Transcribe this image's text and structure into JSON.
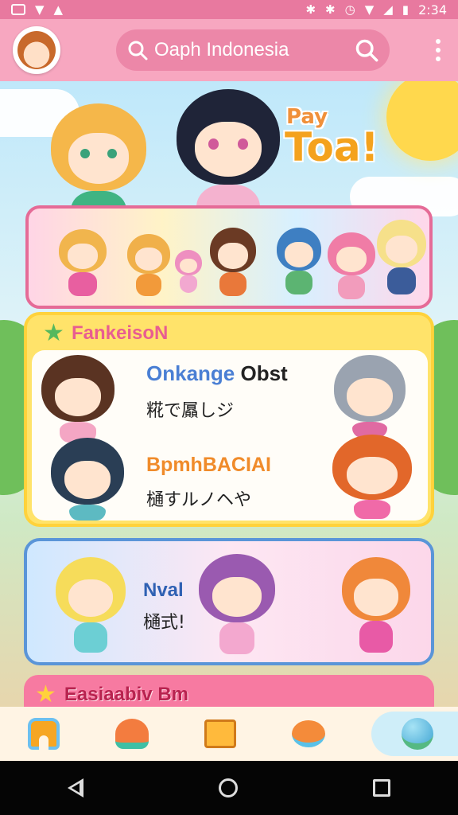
{
  "status_bar": {
    "time": "2:34",
    "icons_left": [
      "gallery-icon",
      "shield-icon",
      "home-icon"
    ],
    "icons_right": [
      "bluetooth-icon",
      "vibrate-icon",
      "alarm-icon",
      "wifi-icon",
      "signal-icon",
      "battery-icon"
    ]
  },
  "app_bar": {
    "avatar": "avatar",
    "search": {
      "value": "Oaph Indonesia"
    }
  },
  "hero": {
    "subtitle": "Pay",
    "title": "Toa!"
  },
  "featured": {
    "tag": "FankeisoN",
    "title_1_a": "Onkange",
    "title_1_b": "Obst",
    "subtitle_1": "糀で屭しジ",
    "title_2": "BpmhBACIAI",
    "subtitle_2": "樋すルノヘや"
  },
  "panel_2": {
    "title": "Nval",
    "subtitle": "樋式!"
  },
  "section_3": {
    "label": "Easiaabiv Bm"
  },
  "bottom_nav": [
    "home-icon",
    "sparkle-icon",
    "gift-box-icon",
    "character-icon",
    "globe-icon"
  ],
  "colors": {
    "status_bar": "#e8799f",
    "app_bar": "#f7a7c0",
    "search_pill": "#ec87a8",
    "strip_border": "#e56b97",
    "feature_bg": "#ffe36a",
    "panel2_border": "#5a95d8",
    "section3_bg": "#f77aa1"
  }
}
